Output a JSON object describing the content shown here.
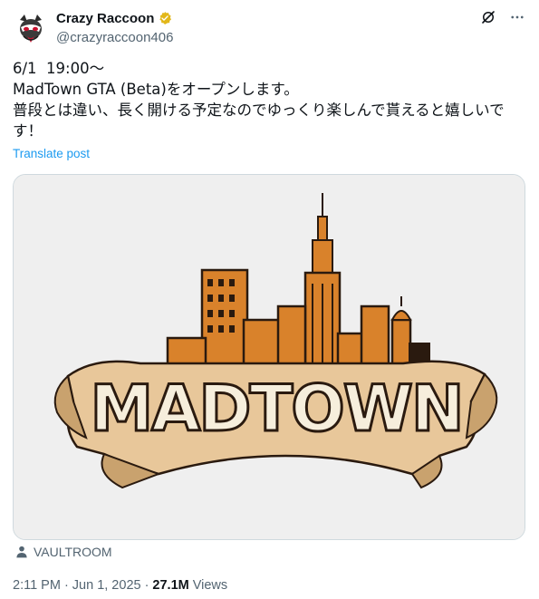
{
  "author": {
    "display_name": "Crazy Raccoon",
    "handle": "@crazyraccoon406",
    "verified": true,
    "avatar_icon": "raccoon-logo-icon"
  },
  "actions": {
    "grok_icon": "grok-icon",
    "more_icon": "more-icon"
  },
  "tweet": {
    "text": "6/1  19:00～\nMadTown GTA (Beta)をオープンします。\n普段とは違い、長く開ける予定なのでゆっくり楽しんで貰えると嬉しいで\nす！",
    "translate_label": "Translate post"
  },
  "media": {
    "logo_text": "MADTOWN",
    "tag": "VAULTROOM",
    "tag_icon": "person-icon"
  },
  "meta": {
    "time": "2:11 PM",
    "separator": "·",
    "date": "Jun 1, 2025",
    "views_count": "27.1M",
    "views_label": "Views"
  },
  "colors": {
    "link": "#1d9bf0",
    "secondary_text": "#536471",
    "verified_gold": "#e2b719",
    "building_orange": "#d9822b",
    "banner": "#e8c79a"
  }
}
